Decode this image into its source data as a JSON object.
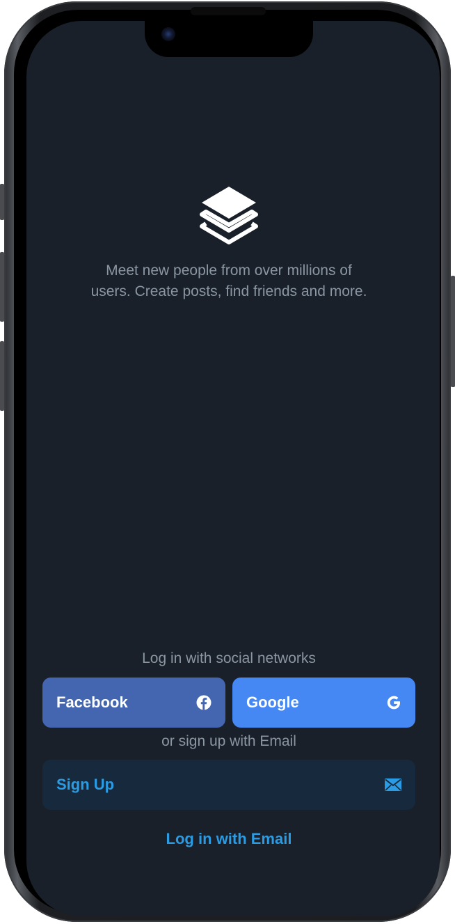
{
  "app": {
    "tagline_line1": "Meet new people from over millions of",
    "tagline_line2": "users. Create posts, find friends and more.",
    "logo_icon": "stacked-layers-icon"
  },
  "auth": {
    "social_caption": "Log in with social networks",
    "facebook_label": "Facebook",
    "facebook_icon": "facebook-icon",
    "google_label": "Google",
    "google_icon": "google-icon",
    "or_caption": "or sign up with Email",
    "signup_label": "Sign Up",
    "signup_icon": "envelope-icon",
    "login_email_label": "Log in with Email"
  },
  "colors": {
    "background": "#19202a",
    "facebook": "#4466b0",
    "google": "#4587f3",
    "signup_bg": "#172a3d",
    "accent": "#2b9be3",
    "muted_text": "#8b96a3"
  }
}
